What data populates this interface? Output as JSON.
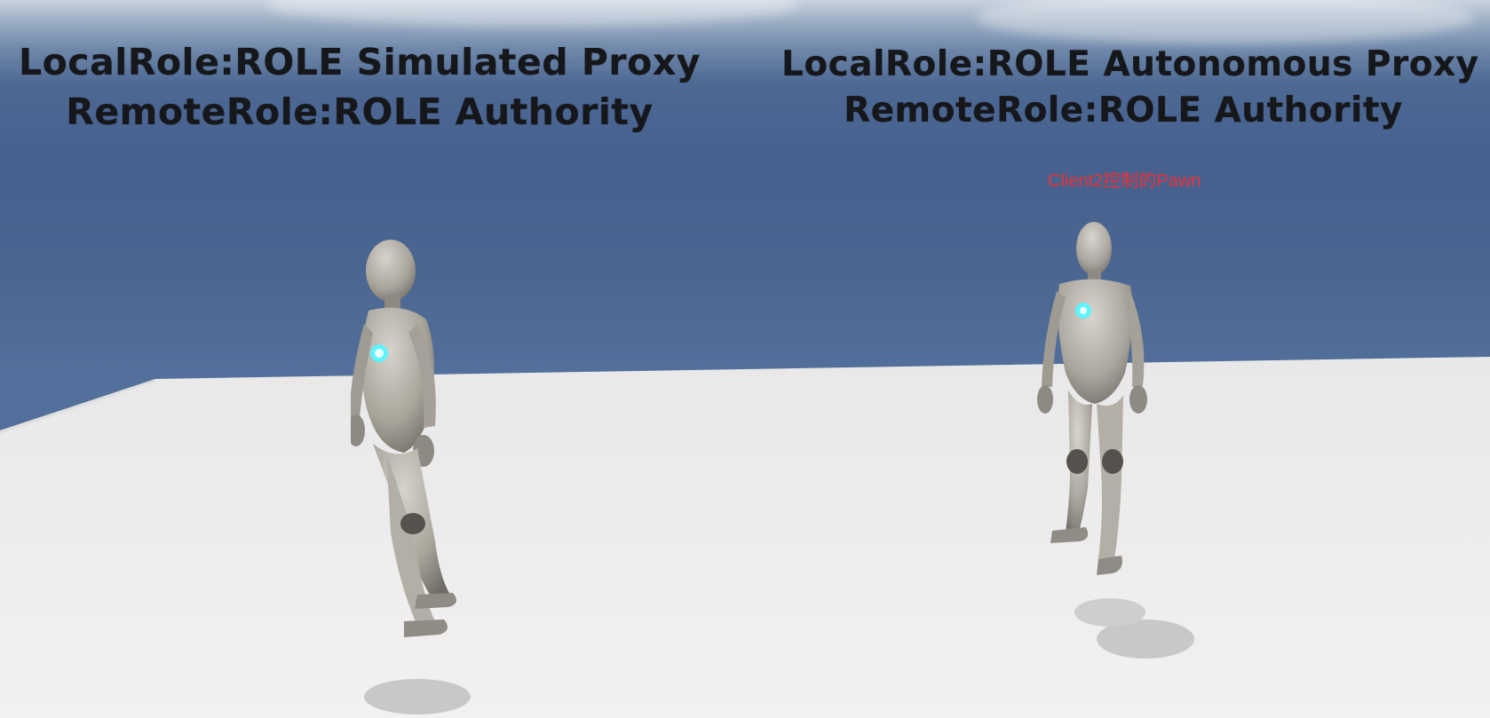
{
  "scene": {
    "sky_color": "#46618e",
    "floor_color": "#f0efee",
    "floor_shadow_color": "#d9d8d8",
    "emissive_color": "#5ff2ff"
  },
  "labels": {
    "left": {
      "local_role": "LocalRole:ROLE Simulated Proxy",
      "remote_role": "RemoteRole:ROLE Authority"
    },
    "right": {
      "local_role": "LocalRole:ROLE Autonomous Proxy",
      "remote_role": "RemoteRole:ROLE Authority"
    }
  },
  "annotation": {
    "text": "Client2控制的Pawn",
    "color": "#e8323a"
  },
  "characters": [
    {
      "name": "mannequin-left",
      "role": "Simulated Proxy"
    },
    {
      "name": "mannequin-right",
      "role": "Autonomous Proxy"
    }
  ]
}
